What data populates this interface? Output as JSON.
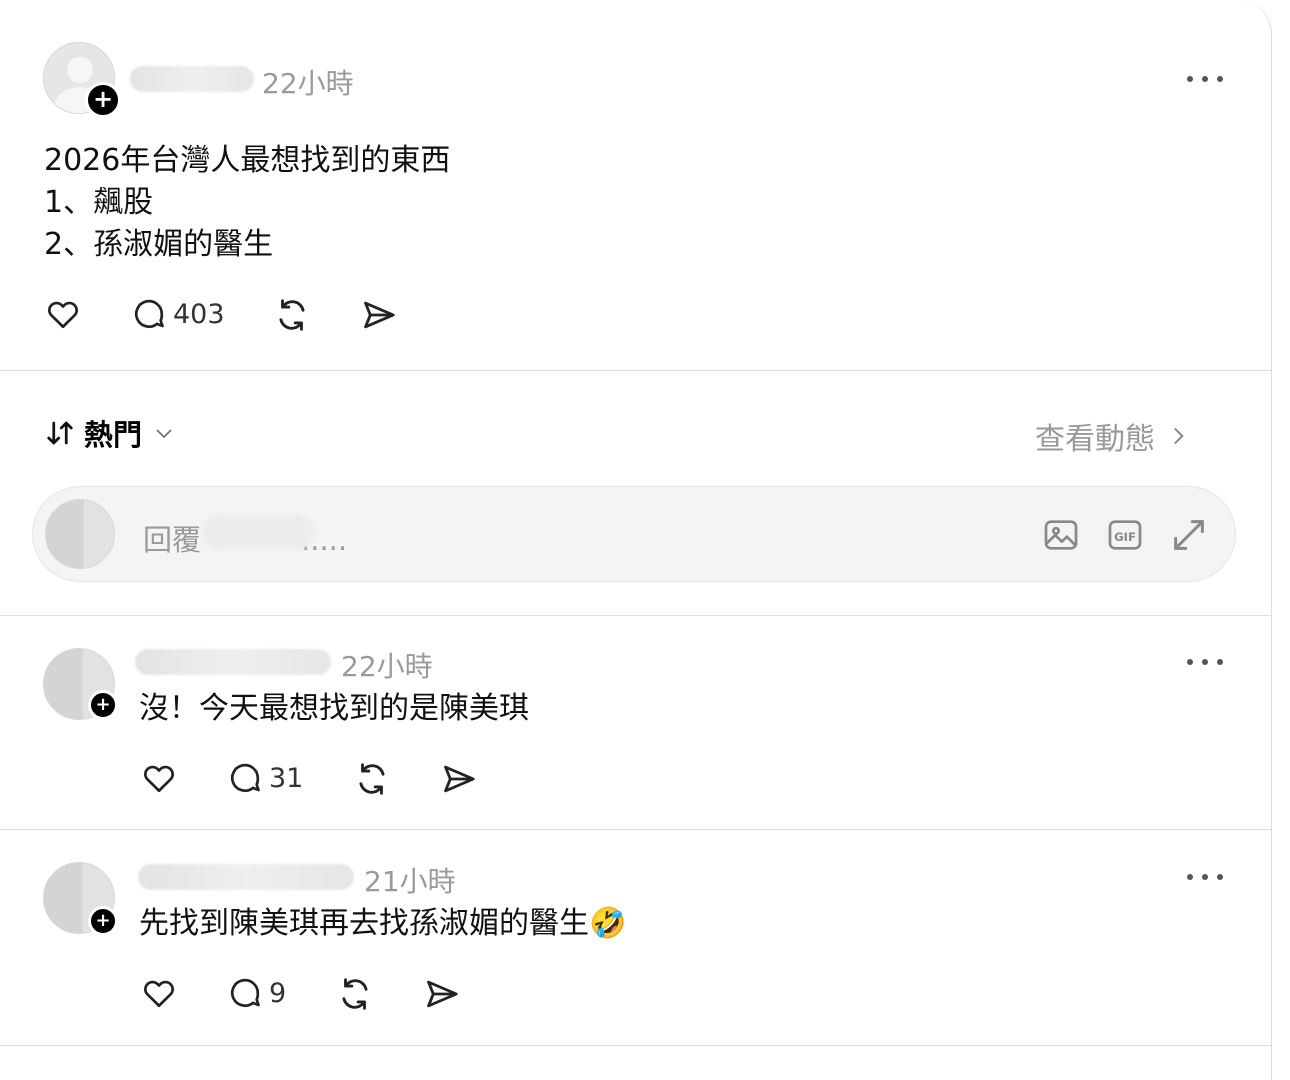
{
  "post": {
    "time": "22小時",
    "text": "2026年台灣人最想找到的東西\n1、飆股\n2、孫淑媚的醫生",
    "reply_count": "403"
  },
  "sort": {
    "label": "熱門",
    "view_activity": "查看動態"
  },
  "reply_box": {
    "placeholder_prefix": "回覆",
    "placeholder_suffix": "....."
  },
  "comments": [
    {
      "time": "22小時",
      "text": "沒！今天最想找到的是陳美琪",
      "reply_count": "31"
    },
    {
      "time": "21小時",
      "text": "先找到陳美琪再去找孫淑媚的醫生🤣",
      "reply_count": "9"
    }
  ],
  "icons": [
    "plus-icon",
    "more-icon",
    "heart-icon",
    "comment-icon",
    "repost-icon",
    "share-icon",
    "sort-icon",
    "chevron-down-icon",
    "chevron-right-icon",
    "image-icon",
    "gif-icon",
    "expand-icon"
  ]
}
